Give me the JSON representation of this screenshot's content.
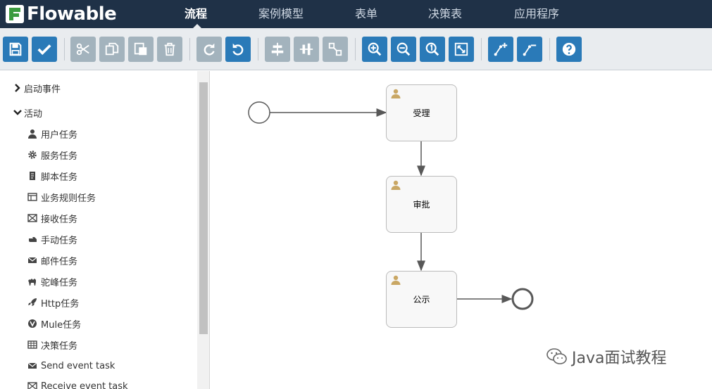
{
  "app": {
    "brand": "Flowable"
  },
  "nav": {
    "tabs": [
      {
        "label": "流程",
        "active": true
      },
      {
        "label": "案例模型"
      },
      {
        "label": "表单"
      },
      {
        "label": "决策表"
      },
      {
        "label": "应用程序"
      }
    ]
  },
  "toolbar": {
    "buttons": [
      "save-icon",
      "validate-check-icon",
      "cut-icon",
      "copy-icon",
      "paste-icon",
      "delete-icon",
      "redo-icon",
      "undo-icon",
      "align-vertical-icon",
      "align-horizontal-icon",
      "same-size-icon",
      "zoom-in-icon",
      "zoom-out-icon",
      "zoom-actual-icon",
      "zoom-fit-icon",
      "add-bendpoint-icon",
      "remove-bendpoint-icon",
      "help-icon"
    ]
  },
  "palette": {
    "groups": [
      {
        "label": "启动事件",
        "expanded": false
      },
      {
        "label": "活动",
        "expanded": true
      }
    ],
    "items": [
      {
        "label": "用户任务",
        "icon": "user-icon"
      },
      {
        "label": "服务任务",
        "icon": "gear-icon"
      },
      {
        "label": "脚本任务",
        "icon": "script-icon"
      },
      {
        "label": "业务规则任务",
        "icon": "table-icon"
      },
      {
        "label": "接收任务",
        "icon": "envelope-open-icon"
      },
      {
        "label": "手动任务",
        "icon": "hand-icon"
      },
      {
        "label": "邮件任务",
        "icon": "envelope-icon"
      },
      {
        "label": "驼峰任务",
        "icon": "camel-icon"
      },
      {
        "label": "Http任务",
        "icon": "rocket-icon"
      },
      {
        "label": "Mule任务",
        "icon": "mule-icon"
      },
      {
        "label": "决策任务",
        "icon": "table-icon"
      },
      {
        "label": "Send event task",
        "icon": "envelope-icon"
      },
      {
        "label": "Receive event task",
        "icon": "envelope-open-icon"
      }
    ]
  },
  "diagram": {
    "tasks": [
      {
        "label": "受理"
      },
      {
        "label": "审批"
      },
      {
        "label": "公示"
      }
    ]
  },
  "watermark": {
    "text": "Java面试教程"
  },
  "colors": {
    "nav_bg": "#1f3147",
    "button_blue": "#2a7ab8",
    "button_gray": "#a3b3bd",
    "logo_green": "#3b9b3f",
    "user_icon": "#c9a764"
  }
}
